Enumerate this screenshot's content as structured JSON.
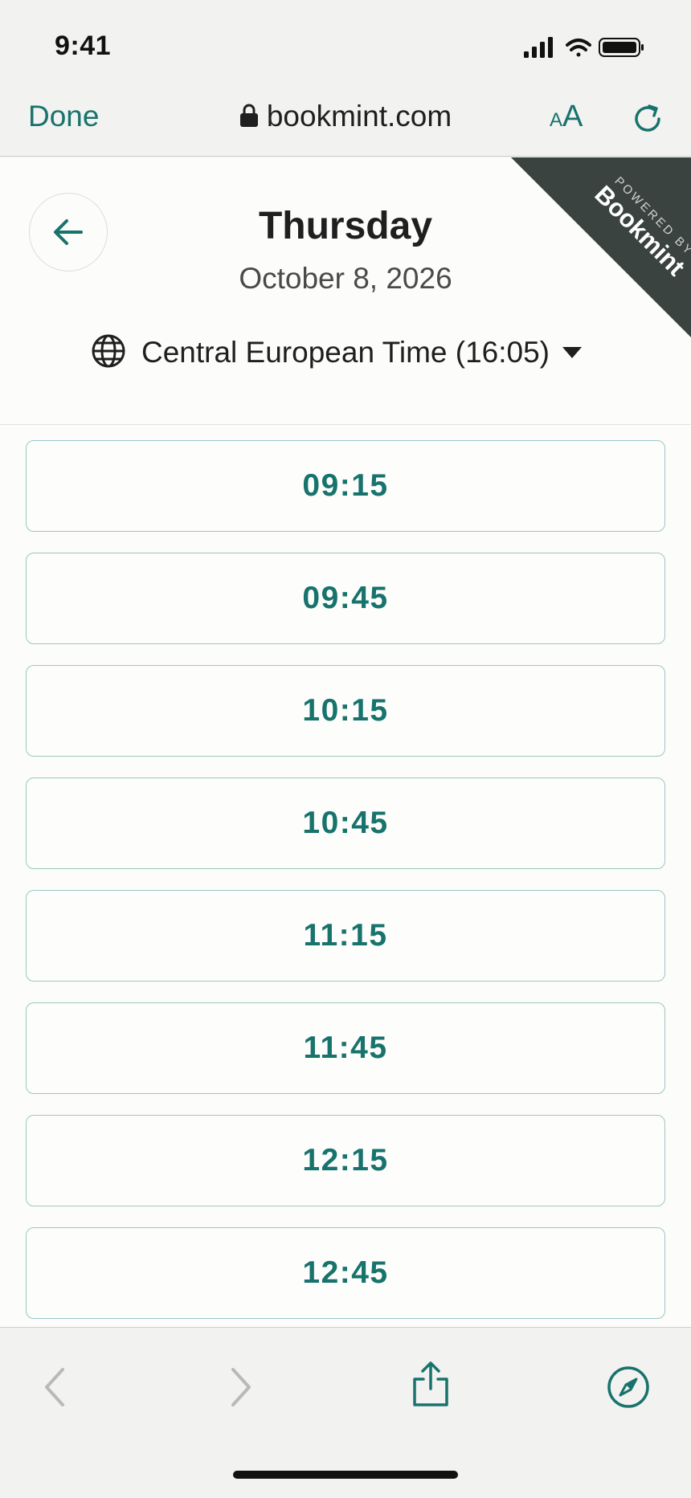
{
  "status_bar": {
    "time": "9:41"
  },
  "browser": {
    "done_label": "Done",
    "url": "bookmint.com",
    "text_size_small": "A",
    "text_size_big": "A"
  },
  "header": {
    "day": "Thursday",
    "date": "October 8, 2026",
    "timezone": "Central European Time (16:05)",
    "ribbon_small": "POWERED BY",
    "ribbon_brand": "Bookmint"
  },
  "slots": [
    "09:15",
    "09:45",
    "10:15",
    "10:45",
    "11:15",
    "11:45",
    "12:15",
    "12:45"
  ],
  "colors": {
    "accent": "#17736c",
    "ribbon": "#3a4340",
    "slot_border": "#9cc7c3"
  }
}
